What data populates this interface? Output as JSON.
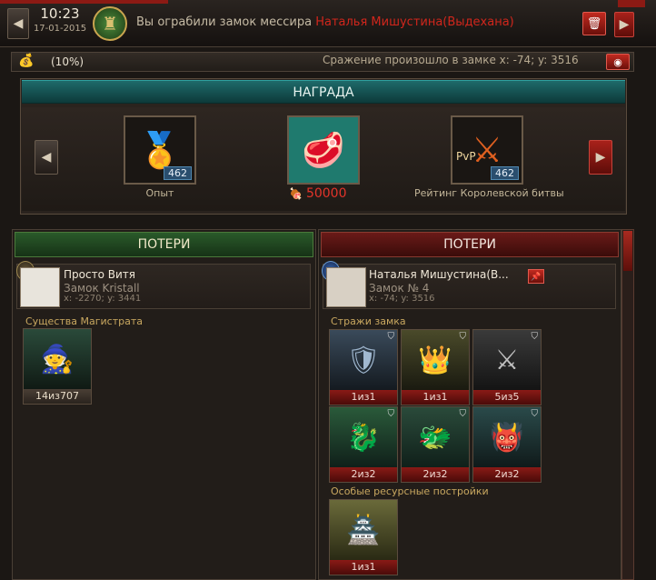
{
  "header": {
    "time": "10:23",
    "date": "17-01-2015",
    "message_prefix": "Вы ограбили замок мессира",
    "message_target": "Наталья Мишустина(Выдехана)",
    "prev_icon": "chevron-left-icon",
    "next_icon": "chevron-right-icon",
    "delete_icon": "trash-icon"
  },
  "infobar": {
    "percent": "(10%)",
    "battle_text": "Сражение произошло в замке x: -74; y: 3516"
  },
  "reward": {
    "title": "НАГРАДА",
    "items": [
      {
        "label": "Опыт",
        "count": "462"
      },
      {
        "label": "",
        "amount": "50000"
      },
      {
        "label": "Рейтинг Королевской битвы",
        "count": "462",
        "tag": "PvP"
      }
    ]
  },
  "left": {
    "title": "ПОТЕРИ",
    "player_name": "Просто Витя",
    "castle": "Замок Kristall",
    "coords": "x: -2270; y: 3441",
    "section": "Существа Магистрата",
    "units": [
      {
        "count": "14из707"
      }
    ]
  },
  "right": {
    "title": "ПОТЕРИ",
    "player_name": "Наталья Мишустина(В...",
    "castle": "Замок № 4",
    "coords": "x: -74; y: 3516",
    "section_guards": "Стражи замка",
    "guards": [
      {
        "count": "1из1"
      },
      {
        "count": "1из1"
      },
      {
        "count": "5из5"
      },
      {
        "count": "2из2"
      },
      {
        "count": "2из2"
      },
      {
        "count": "2из2"
      }
    ],
    "section_buildings": "Особые ресурсные постройки",
    "buildings": [
      {
        "count": "1из1"
      }
    ]
  },
  "colors": {
    "accent_red": "#d1261c",
    "teal_header": "#1e6a6a",
    "green_header": "#2a5a2a",
    "red_header": "#6a1a18"
  }
}
